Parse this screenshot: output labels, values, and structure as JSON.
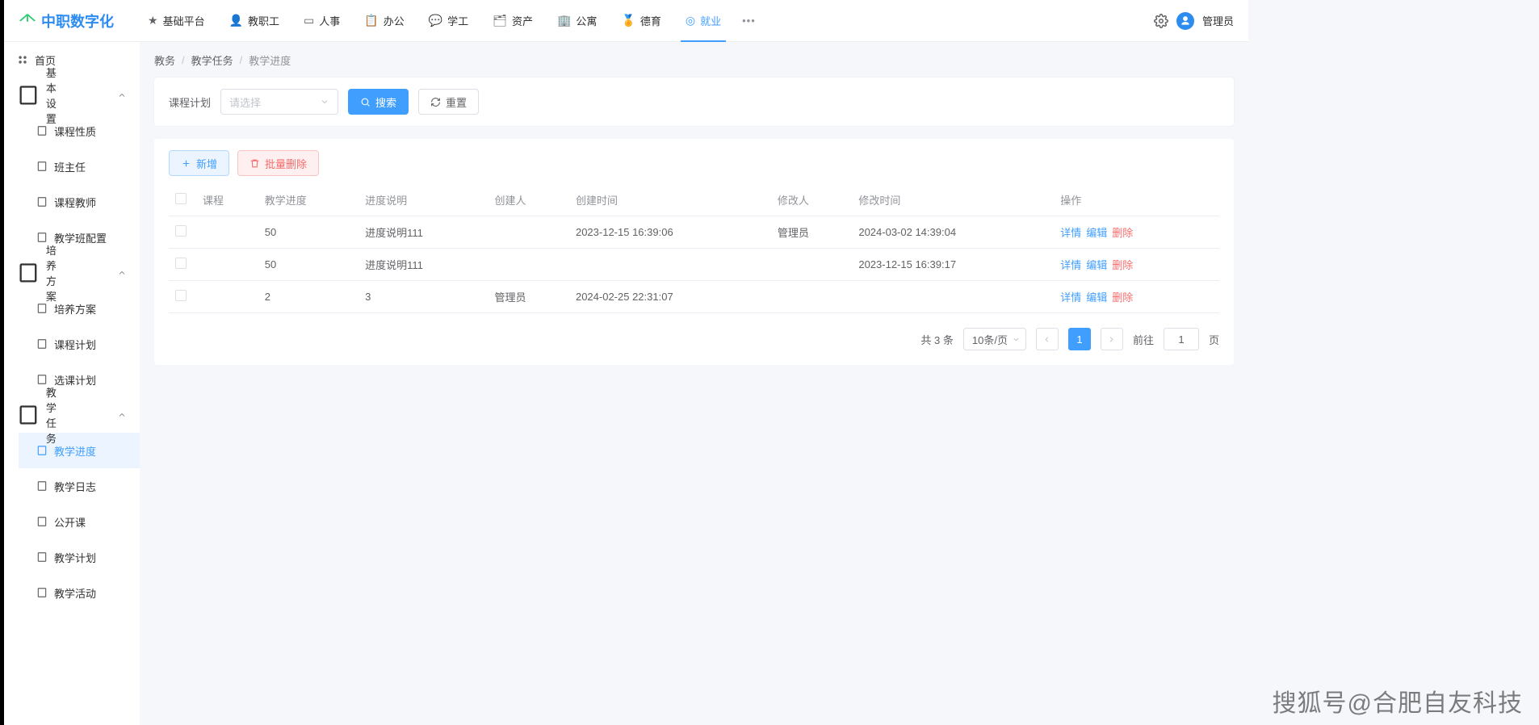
{
  "brand": "中职数字化",
  "topnav": [
    {
      "icon": "star",
      "label": "基础平台"
    },
    {
      "icon": "user",
      "label": "教职工"
    },
    {
      "icon": "id",
      "label": "人事"
    },
    {
      "icon": "clip",
      "label": "办公"
    },
    {
      "icon": "chat",
      "label": "学工"
    },
    {
      "icon": "asset",
      "label": "资产"
    },
    {
      "icon": "cal",
      "label": "公寓"
    },
    {
      "icon": "badge",
      "label": "德育"
    },
    {
      "icon": "target",
      "label": "就业"
    }
  ],
  "user_label": "管理员",
  "sidebar": {
    "home": "首页",
    "g1": {
      "label": "基本设置",
      "items": [
        "课程性质",
        "班主任",
        "课程教师",
        "教学班配置"
      ]
    },
    "g2": {
      "label": "培养方案",
      "items": [
        "培养方案",
        "课程计划",
        "选课计划"
      ]
    },
    "g3": {
      "label": "教学任务",
      "items": [
        "教学进度",
        "教学日志",
        "公开课",
        "教学计划",
        "教学活动"
      ]
    }
  },
  "breadcrumb": [
    "教务",
    "教学任务",
    "教学进度"
  ],
  "filter": {
    "label": "课程计划",
    "placeholder": "请选择",
    "search": "搜索",
    "reset": "重置"
  },
  "buttons": {
    "add": "新增",
    "batchdel": "批量删除"
  },
  "columns": [
    "课程",
    "教学进度",
    "进度说明",
    "创建人",
    "创建时间",
    "修改人",
    "修改时间",
    "操作"
  ],
  "rows": [
    {
      "course": "",
      "progress": "50",
      "desc": "进度说明111",
      "creator": "",
      "ctime": "2023-12-15 16:39:06",
      "modifier": "管理员",
      "mtime": "2024-03-02 14:39:04"
    },
    {
      "course": "",
      "progress": "50",
      "desc": "进度说明111",
      "creator": "",
      "ctime": "",
      "modifier": "",
      "mtime": "2023-12-15 16:39:17"
    },
    {
      "course": "",
      "progress": "2",
      "desc": "3",
      "creator": "管理员",
      "ctime": "2024-02-25 22:31:07",
      "modifier": "",
      "mtime": ""
    }
  ],
  "ops": {
    "detail": "详情",
    "edit": "编辑",
    "del": "删除"
  },
  "pager": {
    "total": "共 3 条",
    "size": "10条/页",
    "goto_pre": "前往",
    "goto_suf": "页",
    "page": "1",
    "jump": "1"
  },
  "watermark": "搜狐号@合肥自友科技"
}
